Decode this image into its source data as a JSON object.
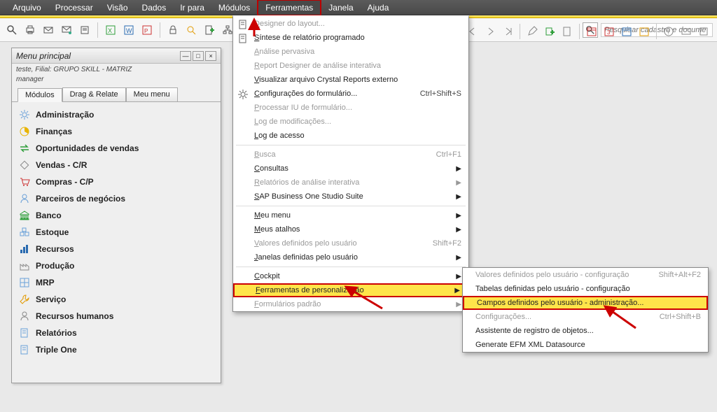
{
  "menubar": {
    "items": [
      "Arquivo",
      "Processar",
      "Visão",
      "Dados",
      "Ir para",
      "Módulos",
      "Ferramentas",
      "Janela",
      "Ajuda"
    ]
  },
  "search": {
    "placeholder": "Pesquisar cadastro e docume"
  },
  "panel": {
    "title": "Menu principal",
    "subtitle": "teste, Filial: GRUPO SKILL - MATRIZ",
    "user": "manager",
    "tabs": [
      "Módulos",
      "Drag & Relate",
      "Meu menu"
    ],
    "items": [
      {
        "label": "Administração",
        "icon": "gear",
        "color": "#6aa0d8"
      },
      {
        "label": "Finanças",
        "icon": "pie",
        "color": "#e8b400"
      },
      {
        "label": "Oportunidades de vendas",
        "icon": "swap",
        "color": "#2e9e3a"
      },
      {
        "label": "Vendas - C/R",
        "icon": "diamond",
        "color": "#888"
      },
      {
        "label": "Compras - C/P",
        "icon": "cart",
        "color": "#c33"
      },
      {
        "label": "Parceiros de negócios",
        "icon": "person",
        "color": "#6aa0d8"
      },
      {
        "label": "Banco",
        "icon": "bank",
        "color": "#2e9e3a"
      },
      {
        "label": "Estoque",
        "icon": "boxes",
        "color": "#6aa0d8"
      },
      {
        "label": "Recursos",
        "icon": "bars",
        "color": "#2a6bb0"
      },
      {
        "label": "Produção",
        "icon": "factory",
        "color": "#888"
      },
      {
        "label": "MRP",
        "icon": "grid",
        "color": "#6aa0d8"
      },
      {
        "label": "Serviço",
        "icon": "wrench",
        "color": "#e29a00"
      },
      {
        "label": "Recursos humanos",
        "icon": "person",
        "color": "#888"
      },
      {
        "label": "Relatórios",
        "icon": "doc",
        "color": "#6aa0d8"
      },
      {
        "label": "Triple One",
        "icon": "doc",
        "color": "#6aa0d8"
      }
    ]
  },
  "dropdown": {
    "items": [
      {
        "text": "Designer do layout...",
        "disabled": true,
        "icon": "pencil"
      },
      {
        "text": "Síntese de relatório programado",
        "icon": "doc"
      },
      {
        "text": "Análise pervasiva",
        "disabled": true
      },
      {
        "text": "Report Designer de análise interativa",
        "disabled": true
      },
      {
        "text": "Visualizar arquivo Crystal Reports externo"
      },
      {
        "text": "Configurações do formulário...",
        "shortcut": "Ctrl+Shift+S",
        "icon": "gear"
      },
      {
        "text": "Processar IU de formulário...",
        "disabled": true
      },
      {
        "text": "Log de modificações...",
        "disabled": true
      },
      {
        "text": "Log de acesso"
      },
      {
        "sep": true
      },
      {
        "text": "Busca",
        "shortcut": "Ctrl+F1",
        "disabled": true
      },
      {
        "text": "Consultas",
        "sub": true
      },
      {
        "text": "Relatórios de análise interativa",
        "disabled": true,
        "sub": true
      },
      {
        "text": "SAP Business One Studio Suite",
        "sub": true
      },
      {
        "sep": true
      },
      {
        "text": "Meu menu",
        "sub": true
      },
      {
        "text": "Meus atalhos",
        "sub": true
      },
      {
        "text": "Valores definidos pelo usuário",
        "shortcut": "Shift+F2",
        "disabled": true
      },
      {
        "text": "Janelas definidas pelo usuário",
        "sub": true
      },
      {
        "sep": true
      },
      {
        "text": "Cockpit",
        "sub": true
      },
      {
        "text": "Ferramentas de personalização",
        "sub": true,
        "highlight": true
      },
      {
        "text": "Formulários padrão",
        "disabled": true,
        "sub": true
      }
    ]
  },
  "submenu": {
    "items": [
      {
        "text": "Valores definidos pelo usuário - configuração",
        "shortcut": "Shift+Alt+F2",
        "disabled": true
      },
      {
        "text": "Tabelas definidas pelo usuário - configuração"
      },
      {
        "text": "Campos definidos pelo usuário - administração...",
        "highlight": true
      },
      {
        "text": "Configurações...",
        "shortcut": "Ctrl+Shift+B",
        "disabled": true
      },
      {
        "text": "Assistente de registro de objetos..."
      },
      {
        "text": "Generate EFM XML Datasource"
      }
    ]
  }
}
